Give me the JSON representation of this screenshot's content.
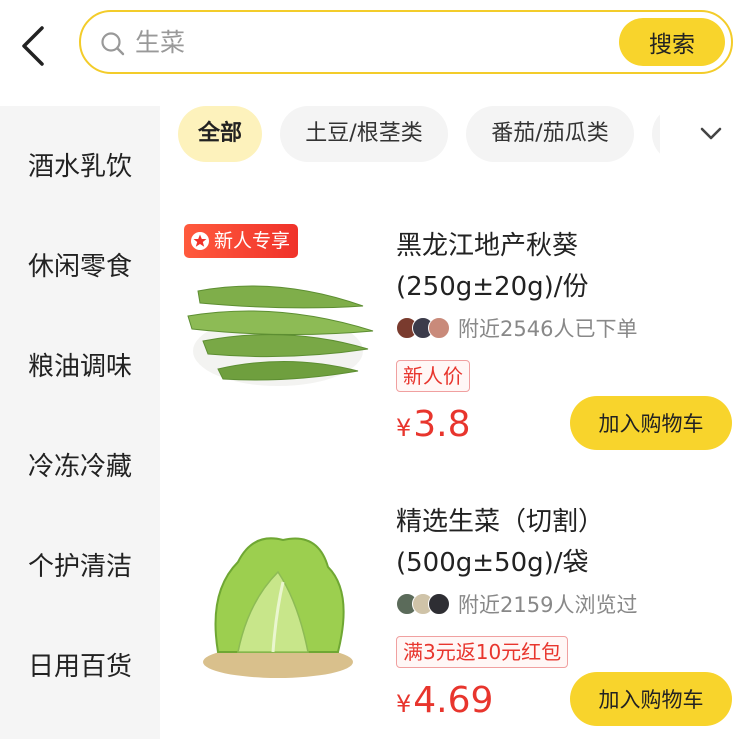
{
  "search": {
    "placeholder": "生菜",
    "button_label": "搜索"
  },
  "sidebar": {
    "items": [
      {
        "label": "酒水乳饮"
      },
      {
        "label": "休闲零食"
      },
      {
        "label": "粮油调味"
      },
      {
        "label": "冷冻冷藏"
      },
      {
        "label": "个护清洁"
      },
      {
        "label": "日用百货"
      }
    ]
  },
  "chips": [
    {
      "label": "全部",
      "active": true
    },
    {
      "label": "土豆/根茎类",
      "active": false
    },
    {
      "label": "番茄/茄瓜类",
      "active": false
    }
  ],
  "products": [
    {
      "tag": "新人专享",
      "title": "黑龙江地产秋葵 (250g±20g)/份",
      "social": "附近2546人已下单",
      "badge": "新人价",
      "price_currency": "¥",
      "price": "3.8",
      "cart_label": "加入购物车",
      "image_icon": "okra-image"
    },
    {
      "tag": "",
      "title": "精选生菜（切割）(500g±50g)/袋",
      "social": "附近2159人浏览过",
      "badge": "满3元返10元红包",
      "price_currency": "¥",
      "price": "4.69",
      "cart_label": "加入购物车",
      "image_icon": "lettuce-image"
    }
  ],
  "colors": {
    "accent": "#f8d42c",
    "price": "#e8352d",
    "chip_active": "#fdf2bc"
  }
}
